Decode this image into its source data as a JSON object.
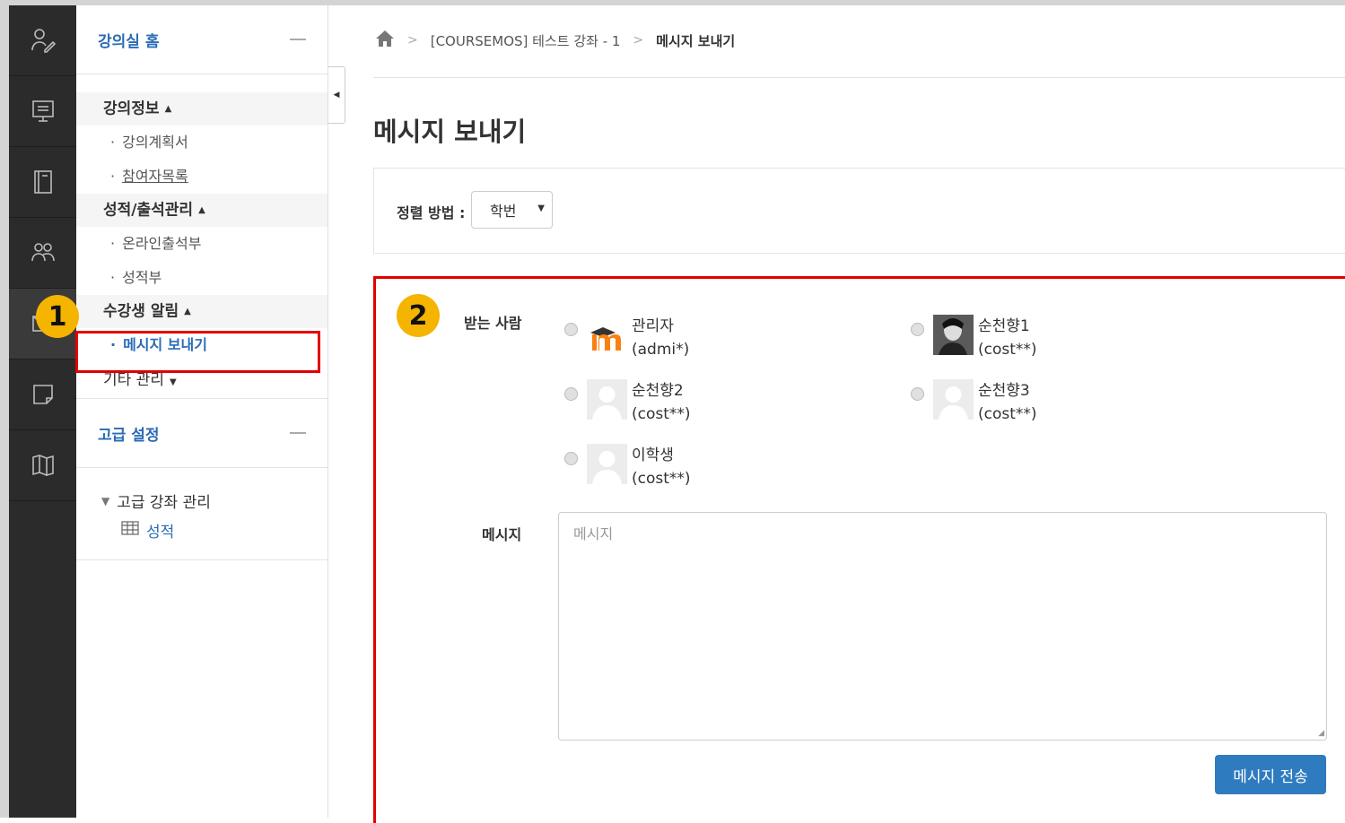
{
  "breadcrumb": {
    "home_icon": "home-icon",
    "course": "[COURSEMOS] 테스트 강좌 - 1",
    "current": "메시지 보내기"
  },
  "sidebar": {
    "home_title": "강의실 홈",
    "groups": [
      {
        "label": "강의정보",
        "items": [
          "강의계획서",
          "참여자목록"
        ]
      },
      {
        "label": "성적/출석관리",
        "items": [
          "온라인출석부",
          "성적부"
        ]
      },
      {
        "label": "수강생 알림",
        "items": [
          "메시지 보내기"
        ]
      }
    ],
    "other": "기타 관리",
    "advanced_title": "고급 설정",
    "tree_parent": "고급 강좌 관리",
    "tree_child": "성적"
  },
  "page": {
    "title": "메시지 보내기"
  },
  "sort": {
    "label": "정렬 방법 :",
    "value": "학번"
  },
  "form": {
    "recipients_label": "받는 사람",
    "recipients": [
      {
        "name": "관리자",
        "id": "(admi*)"
      },
      {
        "name": "순천향1",
        "id": "(cost**)"
      },
      {
        "name": "순천향2",
        "id": "(cost**)"
      },
      {
        "name": "순천향3",
        "id": "(cost**)"
      },
      {
        "name": "이학생",
        "id": "(cost**)"
      }
    ],
    "message_label": "메시지",
    "message_placeholder": "메시지",
    "send_label": "메시지 전송"
  },
  "annotations": {
    "step1": "1",
    "step2": "2"
  },
  "colors": {
    "link_blue": "#2a6cb6",
    "highlight_red": "#e30000",
    "badge_yellow": "#f5b400",
    "button_blue": "#2f7bbf"
  }
}
